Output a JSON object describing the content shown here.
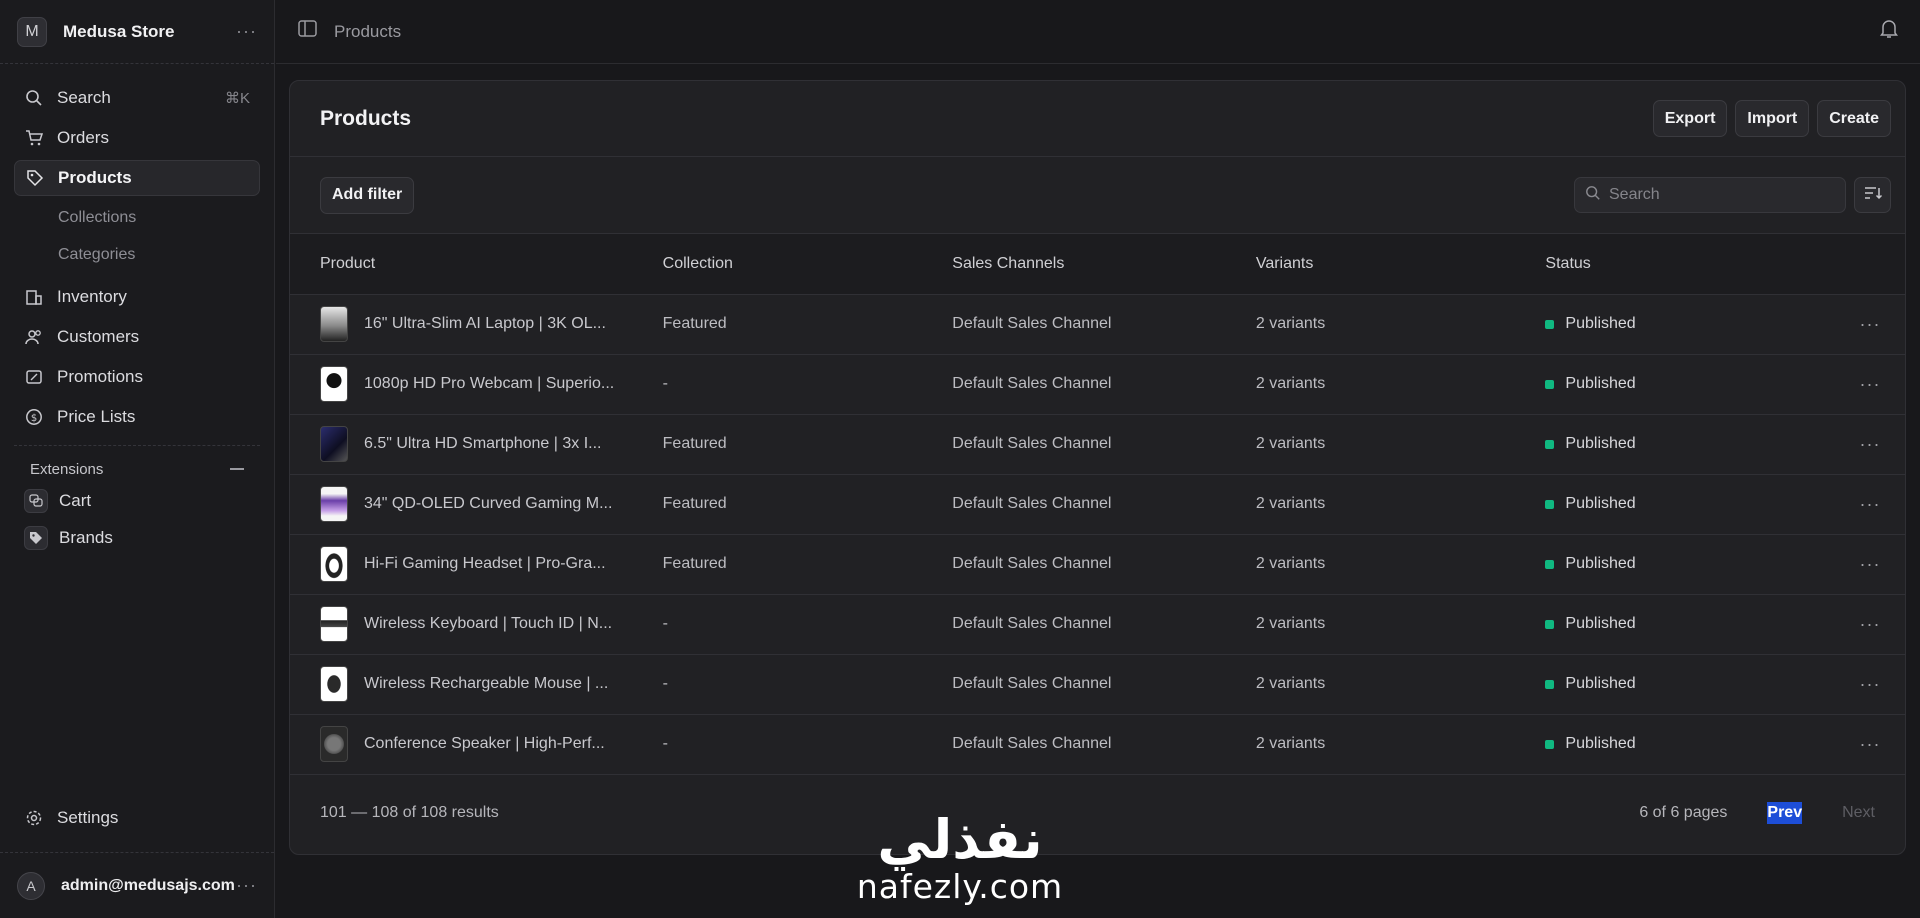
{
  "sidebar": {
    "store": {
      "initial": "M",
      "name": "Medusa Store"
    },
    "search": {
      "label": "Search",
      "shortcut": "⌘K"
    },
    "nav": [
      {
        "label": "Orders",
        "icon": "cart-icon"
      },
      {
        "label": "Products",
        "icon": "tag-icon",
        "active": true
      },
      {
        "label": "Inventory",
        "icon": "building-icon"
      },
      {
        "label": "Customers",
        "icon": "users-icon"
      },
      {
        "label": "Promotions",
        "icon": "receipt-percent-icon"
      },
      {
        "label": "Price Lists",
        "icon": "currency-dollar-icon"
      }
    ],
    "sub_items": [
      "Collections",
      "Categories"
    ],
    "extensions": {
      "heading": "Extensions",
      "items": [
        "Cart",
        "Brands"
      ]
    },
    "settings_label": "Settings",
    "user": {
      "initial": "A",
      "email": "admin@medusajs.com"
    }
  },
  "topbar": {
    "breadcrumb": "Products"
  },
  "main": {
    "title": "Products",
    "buttons": {
      "export": "Export",
      "import": "Import",
      "create": "Create"
    },
    "add_filter_label": "Add filter",
    "search_placeholder": "Search",
    "columns": [
      "Product",
      "Collection",
      "Sales Channels",
      "Variants",
      "Status"
    ],
    "rows": [
      {
        "product": "16\" Ultra-Slim AI Laptop | 3K OL...",
        "collection": "Featured",
        "channel": "Default Sales Channel",
        "variants": "2 variants",
        "status": "Published"
      },
      {
        "product": "1080p HD Pro Webcam | Superio...",
        "collection": "-",
        "channel": "Default Sales Channel",
        "variants": "2 variants",
        "status": "Published"
      },
      {
        "product": "6.5\" Ultra HD Smartphone | 3x I...",
        "collection": "Featured",
        "channel": "Default Sales Channel",
        "variants": "2 variants",
        "status": "Published"
      },
      {
        "product": "34\" QD-OLED Curved Gaming M...",
        "collection": "Featured",
        "channel": "Default Sales Channel",
        "variants": "2 variants",
        "status": "Published"
      },
      {
        "product": "Hi-Fi Gaming Headset | Pro-Gra...",
        "collection": "Featured",
        "channel": "Default Sales Channel",
        "variants": "2 variants",
        "status": "Published"
      },
      {
        "product": "Wireless Keyboard | Touch ID | N...",
        "collection": "-",
        "channel": "Default Sales Channel",
        "variants": "2 variants",
        "status": "Published"
      },
      {
        "product": "Wireless Rechargeable Mouse | ...",
        "collection": "-",
        "channel": "Default Sales Channel",
        "variants": "2 variants",
        "status": "Published"
      },
      {
        "product": "Conference Speaker | High-Perf...",
        "collection": "-",
        "channel": "Default Sales Channel",
        "variants": "2 variants",
        "status": "Published"
      }
    ],
    "footer": {
      "results": "101 — 108 of 108 results",
      "pages": "6 of 6 pages",
      "prev": "Prev",
      "next": "Next"
    }
  },
  "watermark": {
    "arabic": "نفذلي",
    "latin": "nafezly.com"
  },
  "colors": {
    "status_published": "#10b981",
    "prev_highlight": "#1d4ed8",
    "background": "#18181b"
  }
}
